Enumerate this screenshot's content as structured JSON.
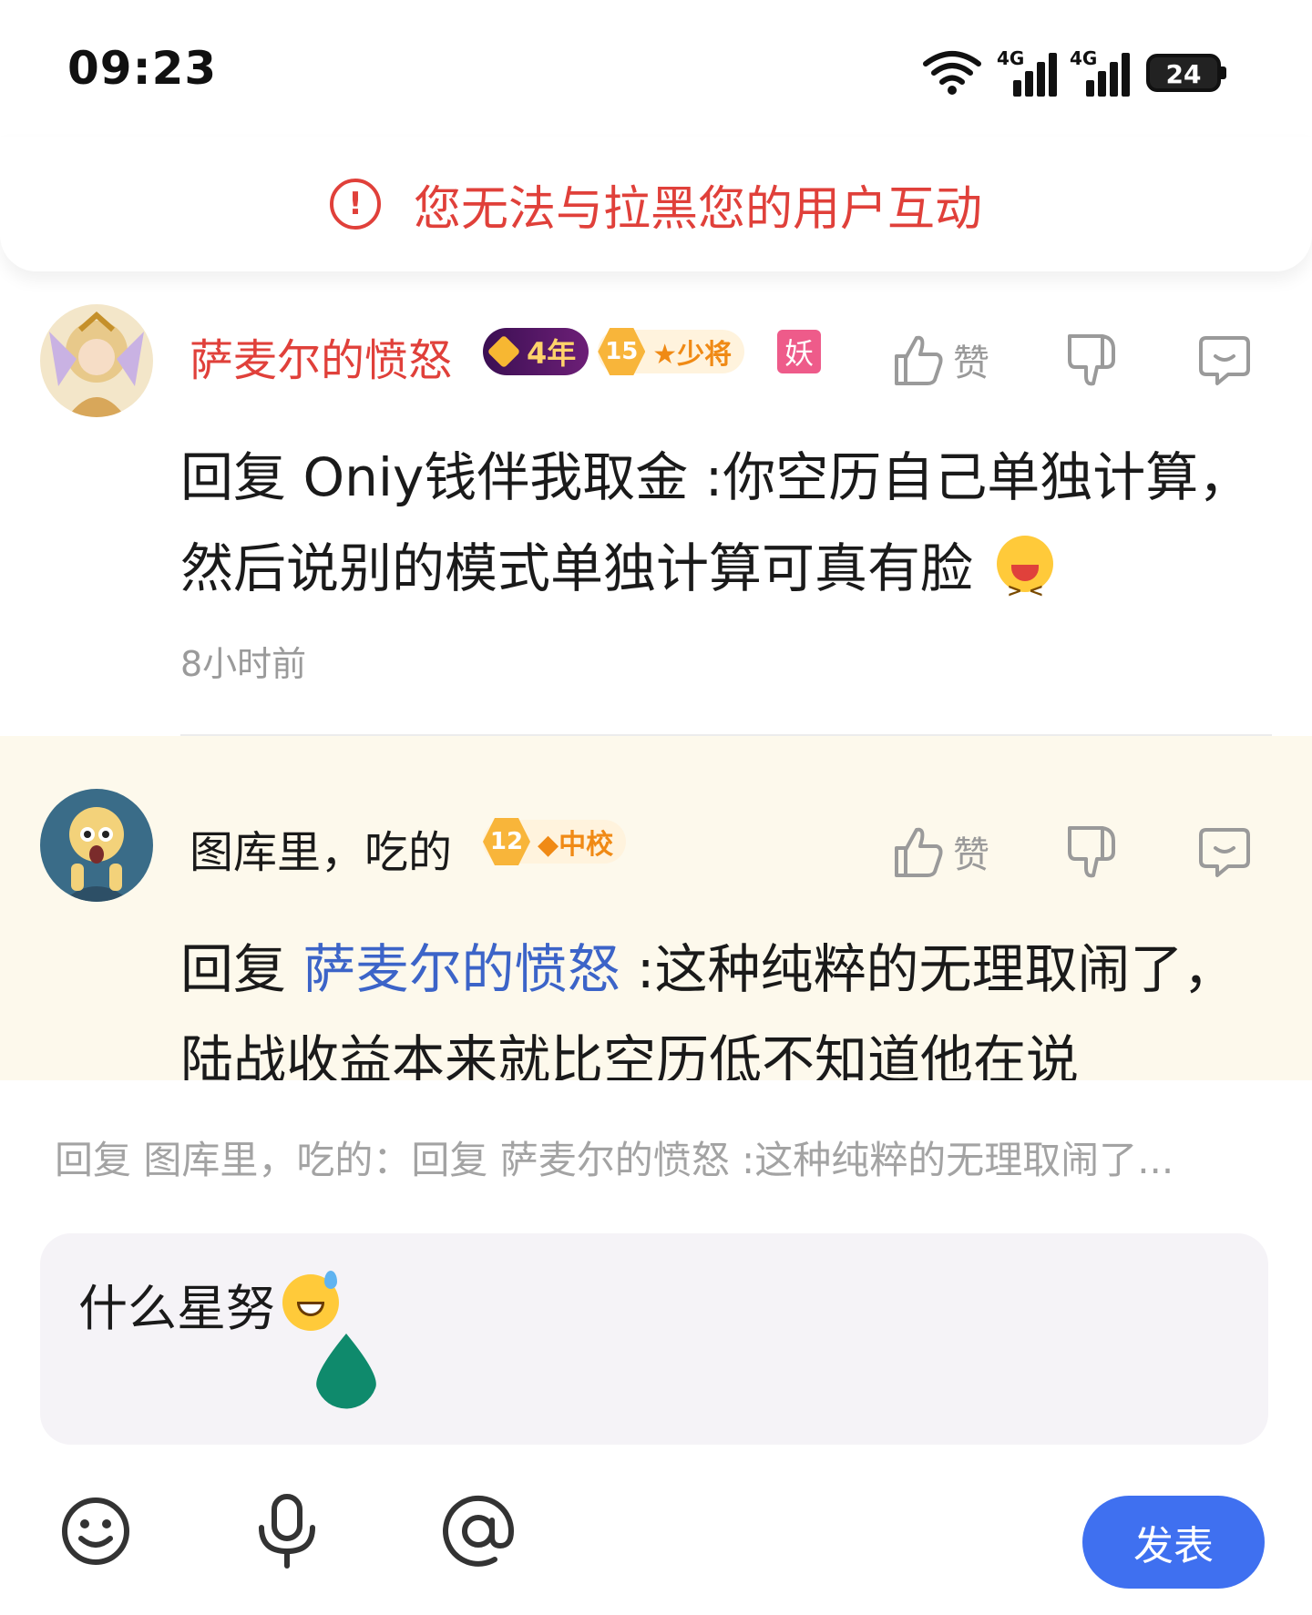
{
  "status_bar": {
    "time": "09:23",
    "battery": "24",
    "network_1": "4G",
    "network_2": "4G"
  },
  "banner": {
    "text": "您无法与拉黑您的用户互动",
    "icon": "alert-circle-icon",
    "color": "#e0403a"
  },
  "comments": [
    {
      "username": "萨麦尔的愤怒",
      "username_color": "#e0403a",
      "vip_badge": "4年",
      "level": "15",
      "rank": "★少将",
      "extra_badge": "妖",
      "like_label": "赞",
      "reply_prefix": "回复",
      "reply_to": " Oniy钱伴我取金 ",
      "text": ":你空历自己单独计算，然后说别的模式单独计算可真有脸",
      "time_ago": "8小时前"
    },
    {
      "username": "图库里，吃的",
      "level": "12",
      "rank": "◆中校",
      "like_label": "赞",
      "reply_prefix": "回复",
      "reply_to": "萨麦尔的愤怒",
      "text": " :这种纯粹的无理取闹了，陆战收益本来就比空历低不知道他在说"
    }
  ],
  "reply_bar": {
    "hint": "回复 图库里，吃的：回复 萨麦尔的愤怒 :这种纯粹的无理取闹了...",
    "input_value": "什么星努",
    "send_label": "发表"
  },
  "colors": {
    "accent": "#3f70f0",
    "highlight_bg": "#fdf9ec",
    "mention": "#3c64c8"
  }
}
